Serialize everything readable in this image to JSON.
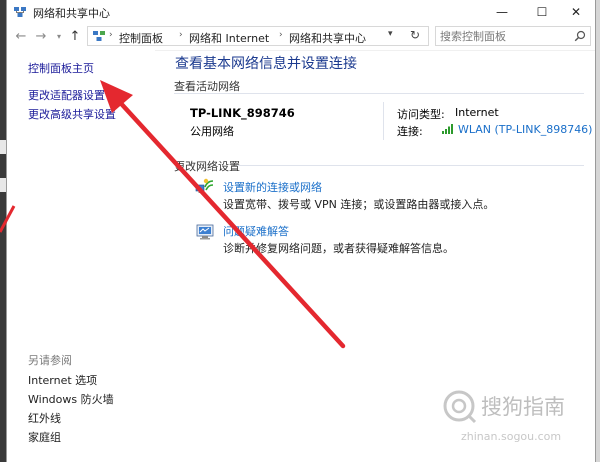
{
  "window": {
    "title": "网络和共享中心",
    "controls": {
      "minimize": "—",
      "maximize": "☐",
      "close": "✕"
    }
  },
  "address": {
    "crumbs": [
      "控制面板",
      "网络和 Internet",
      "网络和共享中心"
    ],
    "search_placeholder": "搜索控制面板"
  },
  "left_pane": {
    "links": [
      "控制面板主页",
      "更改适配器设置",
      "更改高级共享设置"
    ],
    "see_also_title": "另请参阅",
    "see_also": [
      "Internet 选项",
      "Windows 防火墙",
      "红外线",
      "家庭组"
    ]
  },
  "main": {
    "heading": "查看基本网络信息并设置连接",
    "active_section": "查看活动网络",
    "network": {
      "name": "TP-LINK_898746",
      "type": "公用网络",
      "access_label": "访问类型:",
      "access_value": "Internet",
      "connect_label": "连接:",
      "connect_value": "WLAN (TP-LINK_898746)"
    },
    "change_section": "更改网络设置",
    "tasks": [
      {
        "title": "设置新的连接或网络",
        "desc": "设置宽带、拨号或 VPN 连接；或设置路由器或接入点。"
      },
      {
        "title": "问题疑难解答",
        "desc": "诊断并修复网络问题，或者获得疑难解答信息。"
      }
    ]
  },
  "watermark": {
    "text": "搜狗指南",
    "sub": "zhinan.sogou.com"
  },
  "colors": {
    "link": "#1a6fc9",
    "heading": "#1b3a8f",
    "arrow": "#e4282f"
  }
}
